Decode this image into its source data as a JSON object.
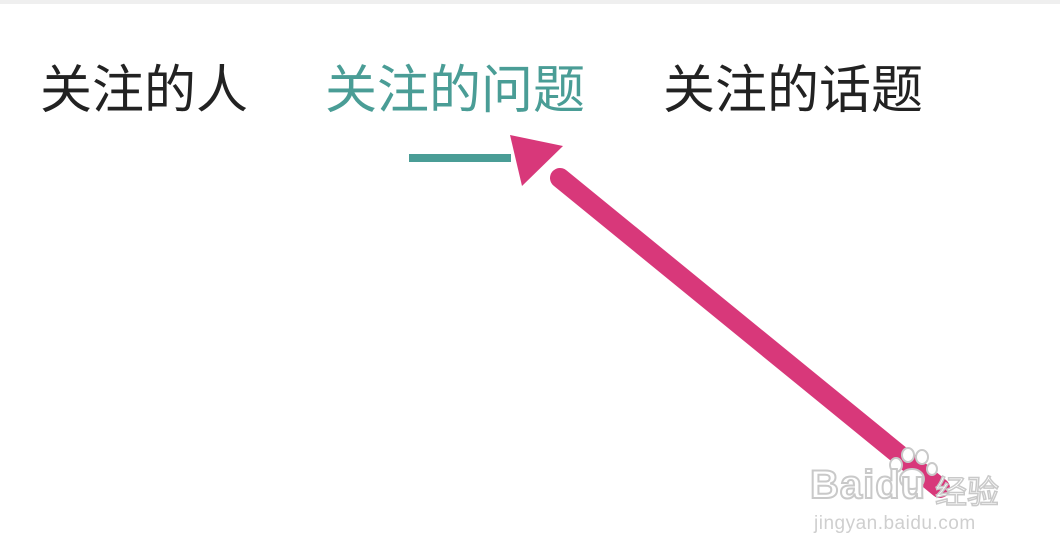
{
  "tabs": [
    {
      "label": "关注的人",
      "active": false
    },
    {
      "label": "关注的问题",
      "active": true
    },
    {
      "label": "关注的话题",
      "active": false
    }
  ],
  "colors": {
    "active_tab": "#4a9d96",
    "inactive_tab": "#222222",
    "annotation_arrow": "#d8387a"
  },
  "annotation": {
    "type": "arrow",
    "icon": "arrow-icon"
  },
  "watermark": {
    "brand": "Baidu",
    "brand_cn": "经验",
    "url": "jingyan.baidu.com",
    "icon": "paw-icon"
  }
}
